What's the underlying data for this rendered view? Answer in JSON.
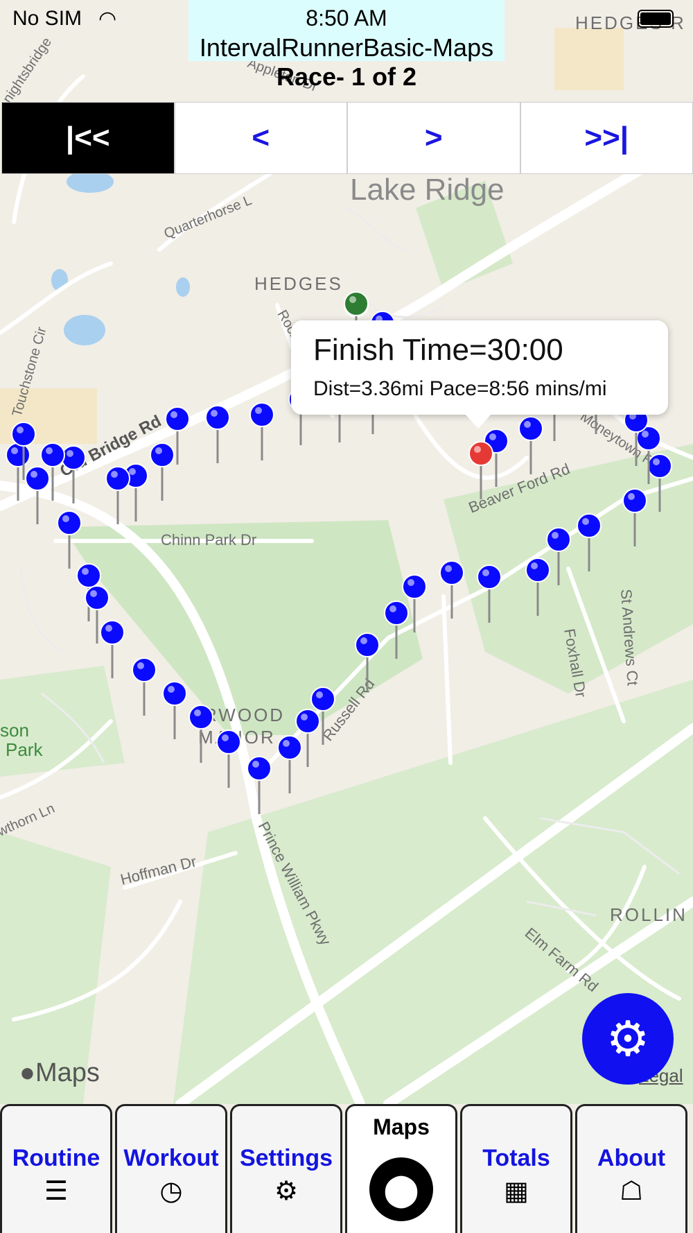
{
  "status": {
    "carrier": "No SIM",
    "time": "8:50 AM"
  },
  "app_title": "IntervalRunnerBasic-Maps",
  "race_label": "Race- 1 of 2",
  "nav": {
    "first": "|<<",
    "prev": "<",
    "next": ">",
    "last": ">>|"
  },
  "callout": {
    "line1": "Finish Time=30:00",
    "line2": "Dist=3.36mi Pace=8:56 mins/mi"
  },
  "map_labels": {
    "lake_ridge": "Lake Ridge",
    "hedges": "HEDGES",
    "hedges_r": "HEDGES R",
    "old_bridge": "Old Bridge Rd",
    "chinn": "Chinn Park Dr",
    "russell": "Russell Rd",
    "beaver_ford": "Beaver Ford Rd",
    "foxhall": "Foxhall Dr",
    "st_andrews": "St Andrews Ct",
    "hoffman": "Hoffman Dr",
    "prince_william": "Prince William Pkwy",
    "elm_farm": "Elm Farm Rd",
    "rolling": "ROLLIN",
    "quarterhorse": "Quarterhorse L",
    "touchstone": "Touchstone Cir",
    "hawthorn": "wthorn Ln",
    "park_a": "son",
    "park_b": "Park",
    "rwood": "RWOOD",
    "manor": "MANOR",
    "knightsbridge": "nightsbridge",
    "appleton": "Appleton Dr",
    "rockwood": "Rockwood",
    "moneytown": "Moneytown Rd"
  },
  "map_branding": {
    "apple_maps": "Maps",
    "legal": "Legal"
  },
  "tabs": [
    {
      "label": "Routine",
      "icon": "list-icon"
    },
    {
      "label": "Workout",
      "icon": "clock-icon"
    },
    {
      "label": "Settings",
      "icon": "gear-icon"
    },
    {
      "label": "Maps",
      "icon": "pin-icon"
    },
    {
      "label": "Totals",
      "icon": "calculator-icon"
    },
    {
      "label": "About",
      "icon": "briefcase-icon"
    }
  ],
  "colors": {
    "accent": "#1414e0",
    "pin_blue": "#0a0aff",
    "pin_start": "#2e7d32",
    "pin_finish": "#e53935"
  }
}
